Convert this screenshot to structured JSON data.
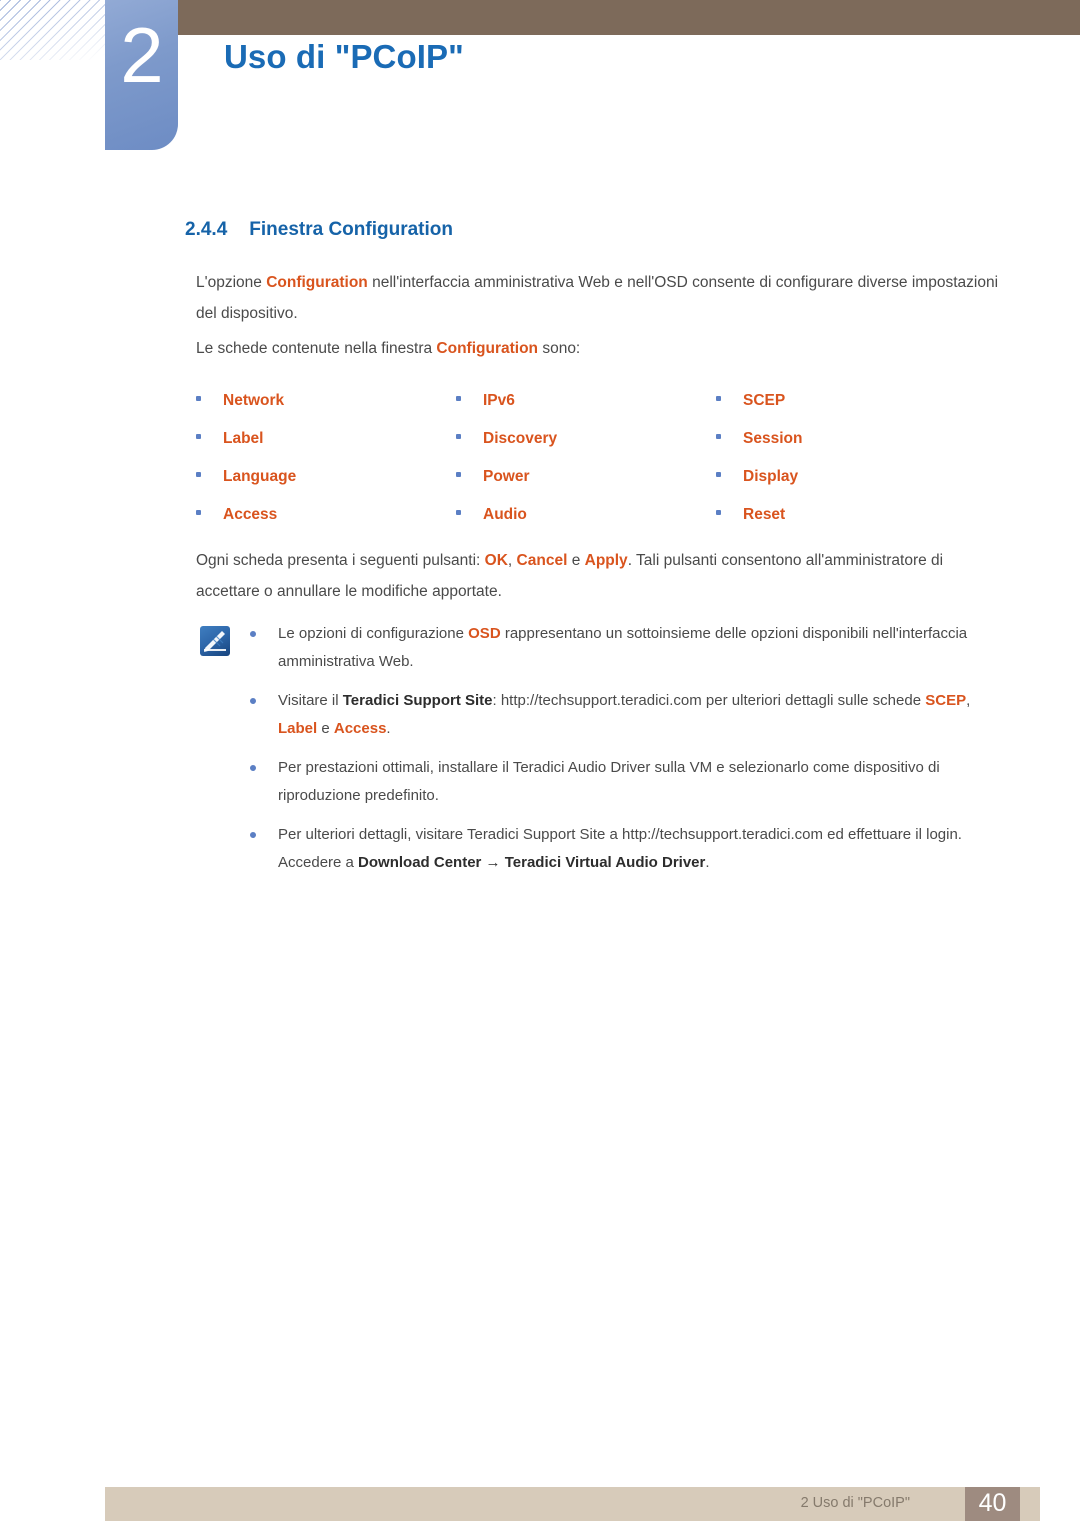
{
  "header": {
    "chapter_number": "2",
    "chapter_title": "Uso di \"PCoIP\"",
    "accent_blue": "#1a6bb5",
    "bar_brown": "#7d6a5a"
  },
  "section": {
    "number": "2.4.4",
    "title": "Finestra Configuration"
  },
  "paragraphs": {
    "p1_a": "L'opzione ",
    "p1_hl": "Configuration",
    "p1_b": " nell'interfaccia amministrativa Web e nell'OSD consente di configurare diverse impostazioni del dispositivo.",
    "p2_a": "Le schede contenute nella finestra ",
    "p2_hl": "Configuration",
    "p2_b": " sono:",
    "p3_a": "Ogni scheda presenta i seguenti pulsanti: ",
    "p3_hl1": "OK",
    "p3_mid1": ", ",
    "p3_hl2": "Cancel",
    "p3_mid2": " e ",
    "p3_hl3": "Apply",
    "p3_b": ". Tali pulsanti consentono all'amministratore di accettare o annullare le modifiche apportate."
  },
  "tab_list": {
    "accent": "#d9541e",
    "bullet_color": "#5b7fc4",
    "rows": [
      {
        "c1": "Network",
        "c2": "IPv6",
        "c3": "SCEP"
      },
      {
        "c1": "Label",
        "c2": "Discovery",
        "c3": "Session"
      },
      {
        "c1": "Language",
        "c2": "Power",
        "c3": "Display"
      },
      {
        "c1": "Access",
        "c2": "Audio",
        "c3": "Reset"
      }
    ]
  },
  "note": {
    "icon_name": "note-pen-icon",
    "items": {
      "n1_a": "Le opzioni di configurazione ",
      "n1_hl": "OSD",
      "n1_b": " rappresentano un sottoinsieme delle opzioni disponibili nell'interfaccia amministrativa Web.",
      "n2_a": "Visitare il ",
      "n2_bold": "Teradici Support Site",
      "n2_b": ": http://techsupport.teradici.com per ulteriori dettagli sulle schede ",
      "n2_hl1": "SCEP",
      "n2_mid1": ", ",
      "n2_hl2": "Label",
      "n2_mid2": " e ",
      "n2_hl3": "Access",
      "n2_end": ".",
      "n3": "Per prestazioni ottimali, installare il Teradici Audio Driver sulla VM e selezionarlo come dispositivo di riproduzione predefinito.",
      "n4_a": "Per ulteriori dettagli, visitare Teradici Support Site a http://techsupport.teradici.com ed effettuare il login. Accedere a ",
      "n4_bold1": "Download Center",
      "n4_arrow": " → ",
      "n4_bold2": "Teradici Virtual Audio Driver",
      "n4_end": "."
    }
  },
  "footer": {
    "label": "2 Uso di \"PCoIP\"",
    "page_number": "40",
    "bar_color": "#d7cbba",
    "page_box_color": "#9e8b80"
  }
}
